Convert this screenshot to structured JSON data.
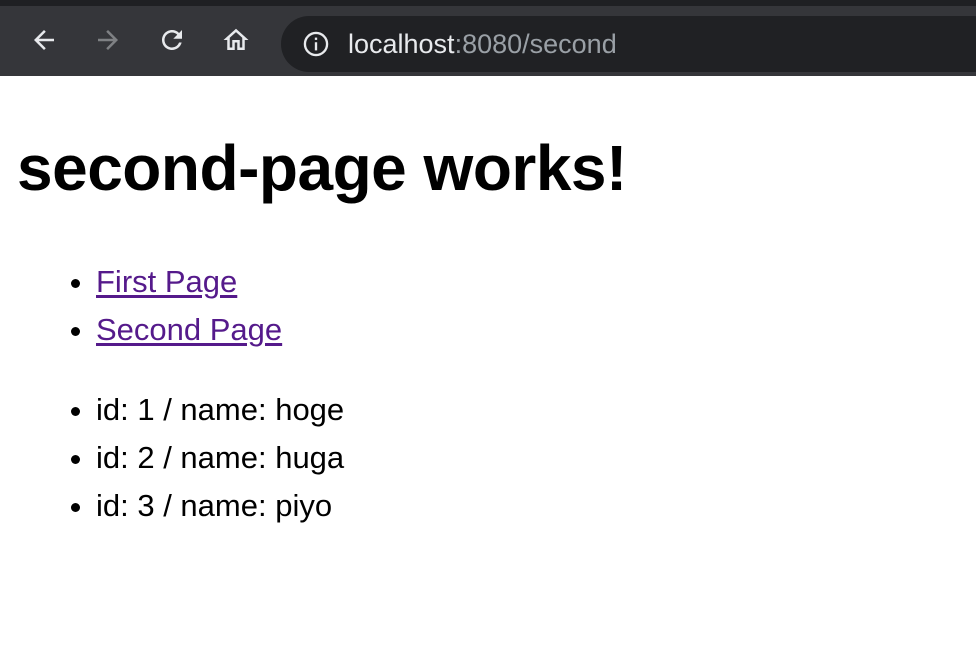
{
  "browser": {
    "url_host": "localhost",
    "url_rest": ":8080/second",
    "icons": {
      "back": "arrow-left-icon",
      "forward": "arrow-right-icon",
      "reload": "reload-icon",
      "home": "home-icon",
      "site_info": "info-icon"
    },
    "colors": {
      "toolbar": "#35363a",
      "omnibox": "#202124",
      "url_host": "#e8eaed",
      "url_rest": "#9aa0a6"
    }
  },
  "page": {
    "heading": "second-page works!",
    "links": [
      {
        "label": "First Page"
      },
      {
        "label": "Second Page"
      }
    ],
    "items": [
      {
        "text": "id: 1 / name: hoge"
      },
      {
        "text": "id: 2 / name: huga"
      },
      {
        "text": "id: 3 / name: piyo"
      }
    ],
    "colors": {
      "link_visited": "#551a8b",
      "text": "#000000"
    }
  }
}
